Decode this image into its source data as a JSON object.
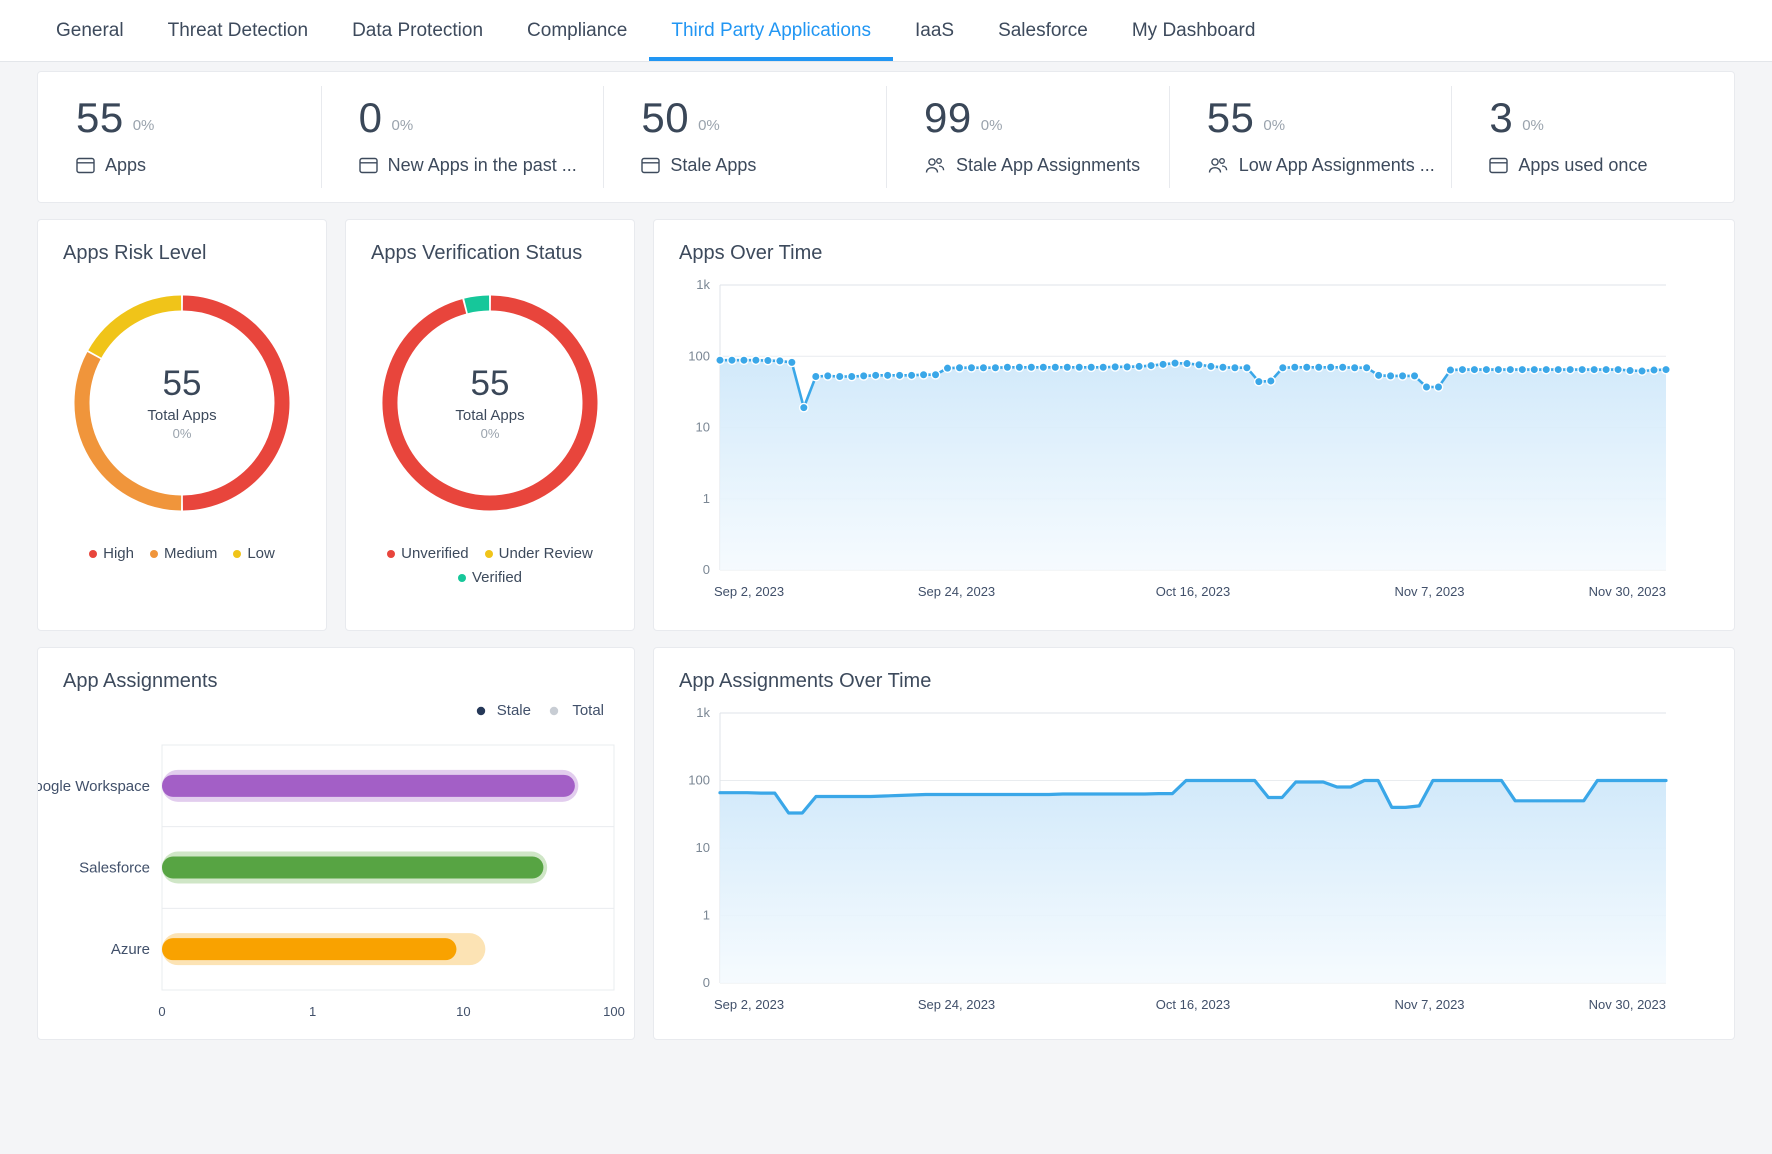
{
  "tabs": [
    {
      "label": "General",
      "active": false
    },
    {
      "label": "Threat Detection",
      "active": false
    },
    {
      "label": "Data Protection",
      "active": false
    },
    {
      "label": "Compliance",
      "active": false
    },
    {
      "label": "Third Party Applications",
      "active": true
    },
    {
      "label": "IaaS",
      "active": false
    },
    {
      "label": "Salesforce",
      "active": false
    },
    {
      "label": "My Dashboard",
      "active": false
    }
  ],
  "kpis": [
    {
      "value": "55",
      "pct": "0%",
      "label": "Apps",
      "icon": "window-icon"
    },
    {
      "value": "0",
      "pct": "0%",
      "label": "New Apps in the past ...",
      "icon": "window-icon"
    },
    {
      "value": "50",
      "pct": "0%",
      "label": "Stale Apps",
      "icon": "window-icon"
    },
    {
      "value": "99",
      "pct": "0%",
      "label": "Stale App Assignments",
      "icon": "users-icon"
    },
    {
      "value": "55",
      "pct": "0%",
      "label": "Low App Assignments ...",
      "icon": "users-icon"
    },
    {
      "value": "3",
      "pct": "0%",
      "label": "Apps used once",
      "icon": "window-icon"
    }
  ],
  "colors": {
    "accent": "#2196f3",
    "red": "#e8453c",
    "orange": "#f0953b",
    "yellow": "#f0c419",
    "teal": "#16c79a",
    "purple": "#a35fc6",
    "purple_light": "#e2cdee",
    "green": "#57a443",
    "green_light": "#cfe6c6",
    "amber": "#f9a200",
    "amber_light": "#fce3b4",
    "line_blue": "#3aa7e8",
    "navy": "#253858",
    "grey": "#c8cdd4"
  },
  "risk": {
    "title": "Apps Risk Level",
    "center_value": "55",
    "center_label": "Total Apps",
    "center_pct": "0%",
    "legend": [
      {
        "label": "High",
        "color": "#e8453c"
      },
      {
        "label": "Medium",
        "color": "#f0953b"
      },
      {
        "label": "Low",
        "color": "#f0c419"
      }
    ],
    "chart_data": {
      "type": "pie",
      "title": "Apps Risk Level",
      "categories": [
        "High",
        "Medium",
        "Low"
      ],
      "values": [
        50,
        33,
        17
      ],
      "colors": [
        "#e8453c",
        "#f0953b",
        "#f0c419"
      ],
      "total": 55,
      "legend_position": "bottom"
    }
  },
  "verification": {
    "title": "Apps Verification Status",
    "center_value": "55",
    "center_label": "Total Apps",
    "center_pct": "0%",
    "legend": [
      {
        "label": "Unverified",
        "color": "#e8453c"
      },
      {
        "label": "Under Review",
        "color": "#f0c419"
      },
      {
        "label": "Verified",
        "color": "#16c79a"
      }
    ],
    "chart_data": {
      "type": "pie",
      "title": "Apps Verification Status",
      "categories": [
        "Unverified",
        "Under Review",
        "Verified"
      ],
      "values": [
        96,
        0,
        4
      ],
      "colors": [
        "#e8453c",
        "#f0c419",
        "#16c79a"
      ],
      "total": 55,
      "legend_position": "bottom"
    }
  },
  "apps_over_time": {
    "title": "Apps Over Time",
    "chart_data": {
      "type": "line",
      "title": "Apps Over Time",
      "xlabel": "",
      "ylabel": "",
      "scale": "log",
      "grid": true,
      "markers": true,
      "area_fill": true,
      "line_color": "#3aa7e8",
      "yticks": [
        "1k",
        "100",
        "10",
        "1",
        "0"
      ],
      "yvalues": [
        1000,
        100,
        10,
        1,
        0
      ],
      "xticks": [
        "Sep 2, 2023",
        "Sep 24, 2023",
        "Oct 16, 2023",
        "Nov 7, 2023",
        "Nov 30, 2023"
      ],
      "x": [
        "Sep 2, 2023",
        "Sep 24, 2023",
        "Oct 16, 2023",
        "Nov 7, 2023",
        "Nov 30, 2023"
      ],
      "values": [
        88,
        88,
        88,
        88,
        87,
        86,
        82,
        19,
        52,
        53,
        52,
        52,
        53,
        54,
        54,
        54,
        54,
        55,
        55,
        68,
        69,
        69,
        69,
        69,
        70,
        70,
        70,
        70,
        70,
        70,
        70,
        70,
        70,
        71,
        71,
        72,
        74,
        77,
        80,
        79,
        76,
        72,
        70,
        69,
        69,
        44,
        45,
        69,
        70,
        70,
        70,
        70,
        70,
        69,
        69,
        54,
        53,
        53,
        53,
        37,
        37,
        64,
        65,
        65,
        65,
        65,
        65,
        65,
        65,
        65,
        65,
        65,
        65,
        65,
        65,
        65,
        63,
        62,
        64,
        65
      ]
    }
  },
  "app_assignments": {
    "title": "App Assignments",
    "legend": [
      {
        "label": "Stale",
        "color": "#253858"
      },
      {
        "label": "Total",
        "color": "#c8cdd4"
      }
    ],
    "chart_data": {
      "type": "bar",
      "orientation": "horizontal",
      "title": "App Assignments",
      "scale": "log",
      "categories": [
        "Google Workspace",
        "Salesforce",
        "Azure"
      ],
      "xticks": [
        "0",
        "1",
        "10",
        "100"
      ],
      "xvalues": [
        0,
        1,
        10,
        100
      ],
      "series": [
        {
          "name": "Stale",
          "values": [
            55,
            34,
            9
          ]
        },
        {
          "name": "Total",
          "values": [
            58,
            36,
            14
          ]
        }
      ],
      "bar_colors": [
        "#a35fc6",
        "#57a443",
        "#f9a200"
      ],
      "bar_colors_light": [
        "#e2cdee",
        "#cfe6c6",
        "#fce3b4"
      ],
      "legend_position": "top-right"
    }
  },
  "app_assignments_over_time": {
    "title": "App Assignments Over Time",
    "chart_data": {
      "type": "area",
      "title": "App Assignments Over Time",
      "xlabel": "",
      "ylabel": "",
      "scale": "log",
      "grid": true,
      "markers": false,
      "area_fill": true,
      "line_color": "#3aa7e8",
      "yticks": [
        "1k",
        "100",
        "10",
        "1",
        "0"
      ],
      "yvalues": [
        1000,
        100,
        10,
        1,
        0
      ],
      "xticks": [
        "Sep 2, 2023",
        "Sep 24, 2023",
        "Oct 16, 2023",
        "Nov 7, 2023",
        "Nov 30, 2023"
      ],
      "x": [
        "Sep 2, 2023",
        "Sep 24, 2023",
        "Oct 16, 2023",
        "Nov 7, 2023",
        "Nov 30, 2023"
      ],
      "values": [
        66,
        66,
        66,
        65,
        65,
        33,
        33,
        58,
        58,
        58,
        58,
        58,
        59,
        60,
        61,
        62,
        62,
        62,
        62,
        62,
        62,
        62,
        62,
        62,
        62,
        63,
        63,
        63,
        63,
        63,
        63,
        63,
        64,
        64,
        100,
        100,
        100,
        100,
        100,
        100,
        56,
        56,
        95,
        95,
        95,
        80,
        80,
        100,
        100,
        40,
        40,
        42,
        100,
        100,
        100,
        100,
        100,
        100,
        50,
        50,
        50,
        50,
        50,
        50,
        100,
        100,
        100,
        100,
        100,
        100
      ]
    }
  }
}
